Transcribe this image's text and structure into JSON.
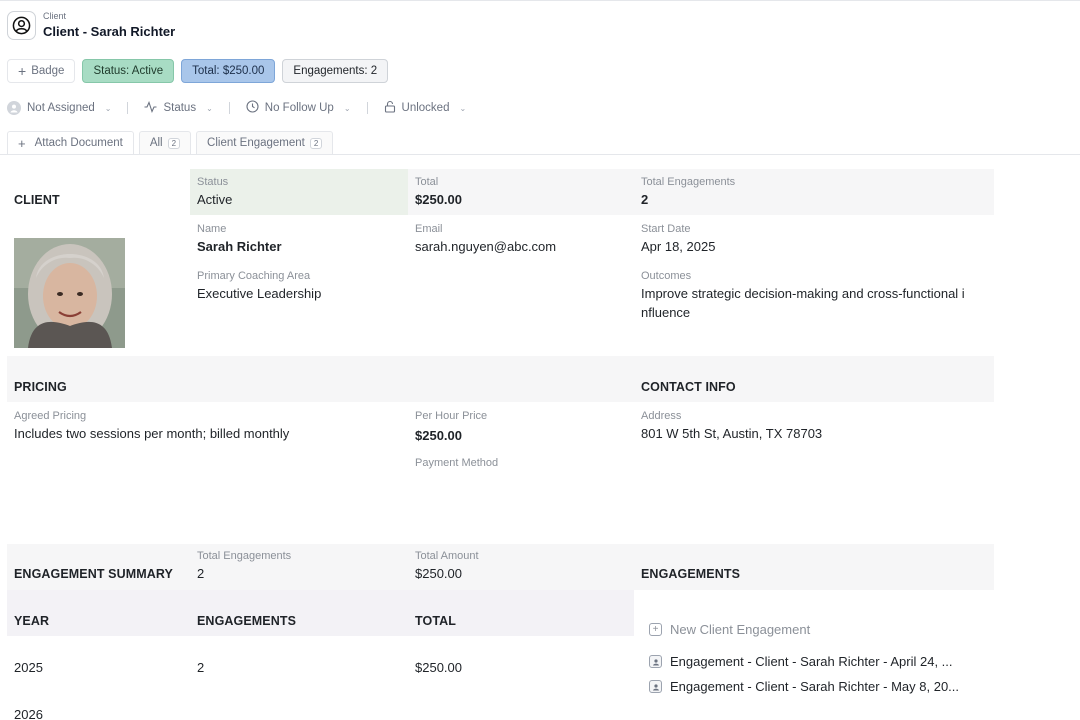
{
  "header": {
    "subtitle": "Client",
    "title": "Client - Sarah Richter"
  },
  "badges": {
    "add_label": "Badge",
    "status": "Status: Active",
    "total": "Total: $250.00",
    "engagements": "Engagements: 2",
    "colors": {
      "status": "#a8dcc4",
      "total": "#a9c6ea",
      "engagements": "#f3f4f6"
    }
  },
  "controls": {
    "assignee": "Not Assigned",
    "status": "Status",
    "follow_up": "No Follow Up",
    "lock": "Unlocked"
  },
  "tabs": [
    {
      "label": "Attach Document"
    },
    {
      "label": "All",
      "count": "2"
    },
    {
      "label": "Client Engagement",
      "count": "2"
    }
  ],
  "client": {
    "section": "CLIENT",
    "status_label": "Status",
    "status": "Active",
    "total_label": "Total",
    "total": "$250.00",
    "total_eng_label": "Total Engagements",
    "total_eng": "2",
    "name_label": "Name",
    "name": "Sarah Richter",
    "email_label": "Email",
    "email": "sarah.nguyen@abc.com",
    "start_label": "Start Date",
    "start": "Apr 18, 2025",
    "area_label": "Primary Coaching Area",
    "area": "Executive Leadership",
    "outcomes_label": "Outcomes",
    "outcomes_line1": "Improve strategic decision-making and cross-functional i",
    "outcomes_line2": "nfluence"
  },
  "pricing": {
    "section": "PRICING",
    "agreed_label": "Agreed Pricing",
    "agreed": "Includes two sessions per month; billed monthly",
    "per_hour_label": "Per Hour Price",
    "per_hour": "$250.00",
    "payment_label": "Payment Method"
  },
  "contact": {
    "section": "CONTACT INFO",
    "address_label": "Address",
    "address": "801 W 5th St, Austin, TX 78703"
  },
  "summary": {
    "section": "ENGAGEMENT SUMMARY",
    "total_eng_label": "Total Engagements",
    "total_eng": "2",
    "total_amount_label": "Total Amount",
    "total_amount": "$250.00",
    "columns": [
      "YEAR",
      "ENGAGEMENTS",
      "TOTAL"
    ],
    "rows": [
      {
        "year": "2025",
        "engagements": "2",
        "total": "$250.00"
      },
      {
        "year": "2026",
        "engagements": "",
        "total": ""
      }
    ]
  },
  "engagements": {
    "section": "ENGAGEMENTS",
    "new_label": "New Client Engagement",
    "items": [
      "Engagement - Client - Sarah Richter - April 24, ...",
      "Engagement - Client - Sarah Richter - May 8, 20..."
    ]
  }
}
